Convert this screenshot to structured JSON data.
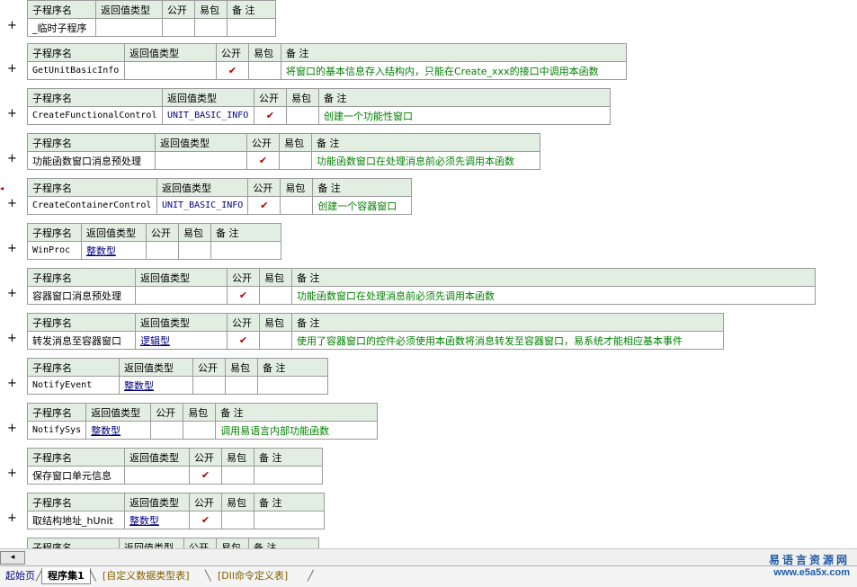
{
  "columns": {
    "name": "子程序名",
    "return_type": "返回值类型",
    "public": "公开",
    "easy_package": "易包",
    "remark": "备 注"
  },
  "check_mark": "✔",
  "plus_sign": "+",
  "subroutines": [
    {
      "name": "_临时子程序",
      "return_type": "",
      "public": false,
      "remark": ""
    },
    {
      "name": "GetUnitBasicInfo",
      "return_type": "",
      "public": true,
      "remark": "将窗口的基本信息存入结构内，只能在Create_xxx的接口中调用本函数"
    },
    {
      "name": "CreateFunctionalControl",
      "return_type": "UNIT_BASIC_INFO",
      "public": true,
      "remark": "创建一个功能性窗口"
    },
    {
      "name": "功能函数窗口消息预处理",
      "return_type": "",
      "public": true,
      "remark": "功能函数窗口在处理消息前必须先调用本函数"
    },
    {
      "name": "CreateContainerControl",
      "return_type": "UNIT_BASIC_INFO",
      "public": true,
      "remark": "创建一个容器窗口"
    },
    {
      "name": "WinProc",
      "return_type": "整数型",
      "public": false,
      "remark": ""
    },
    {
      "name": "容器窗口消息预处理",
      "return_type": "",
      "public": true,
      "remark": "功能函数窗口在处理消息前必须先调用本函数"
    },
    {
      "name": "转发消息至容器窗口",
      "return_type": "逻辑型",
      "public": true,
      "remark": "使用了容器窗口的控件必须使用本函数将消息转发至容器窗口，易系统才能相应基本事件"
    },
    {
      "name": "NotifyEvent",
      "return_type": "整数型",
      "public": false,
      "remark": ""
    },
    {
      "name": "NotifySys",
      "return_type": "整数型",
      "public": false,
      "remark": "调用易语言内部功能函数"
    },
    {
      "name": "保存窗口单元信息",
      "return_type": "",
      "public": true,
      "remark": ""
    },
    {
      "name": "取结构地址_hUnit",
      "return_type": "整数型",
      "public": true,
      "remark": ""
    },
    {
      "name": "",
      "return_type": "",
      "public": false,
      "remark": ""
    }
  ],
  "tabs": {
    "start_page": "起始页",
    "assembly": "程序集1",
    "custom_types": "[自定义数据类型表]",
    "dll_commands": "[Dll命令定义表]"
  },
  "watermark": {
    "title": "易语言资源网",
    "url": "www.e5a5x.com"
  },
  "colors": {
    "header_bg": "#e3eee3",
    "remark_text": "#008000",
    "type_text": "#000080",
    "check_mark": "#b00000",
    "watermark": "#1f5aa8"
  }
}
